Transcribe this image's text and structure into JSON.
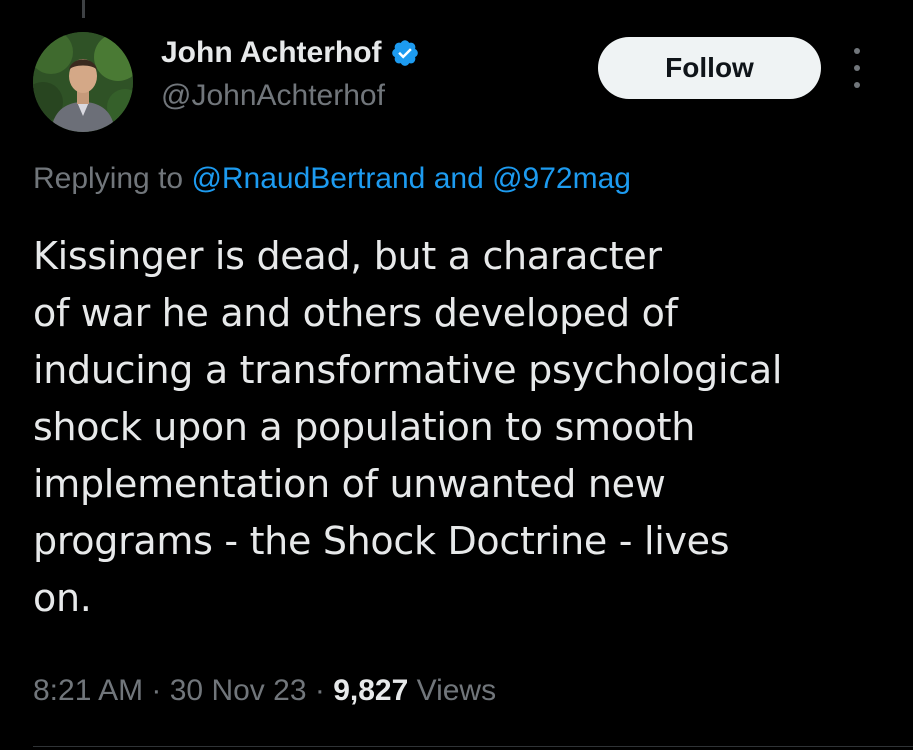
{
  "author": {
    "display_name": "John Achterhof",
    "handle": "@JohnAchterhof",
    "verified": true
  },
  "actions": {
    "follow_label": "Follow"
  },
  "reply": {
    "prefix": "Replying to ",
    "mention_1": "@RnaudBertrand",
    "joiner": " and ",
    "mention_2": "@972mag"
  },
  "tweet": {
    "lines": [
      "Kissinger is dead, but a character",
      "of war he and others developed of",
      "inducing a transformative psychological",
      "shock upon a population to smooth",
      "implementation of unwanted new",
      "programs - the Shock Doctrine - lives",
      "on."
    ]
  },
  "meta": {
    "time": "8:21 AM",
    "separator": " · ",
    "date": "30 Nov 23",
    "views_count": "9,827",
    "views_label": " Views"
  },
  "colors": {
    "background": "#000000",
    "text": "#e7e9ea",
    "secondary": "#71767b",
    "accent": "#1d9bf0",
    "follow_bg": "#eff3f4"
  },
  "icons": {
    "verified": "verified-badge-icon",
    "more": "more-options-icon"
  }
}
